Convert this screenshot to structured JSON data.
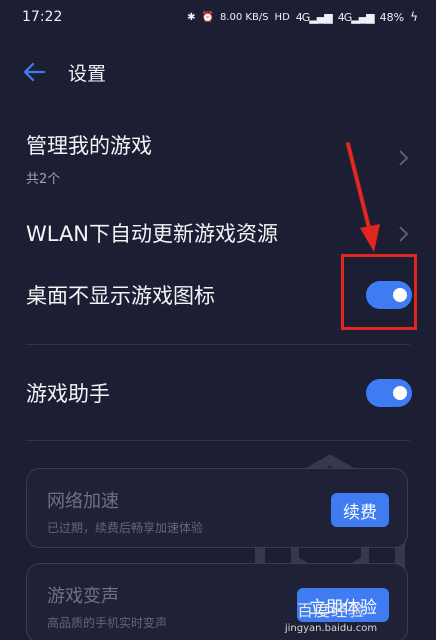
{
  "status_bar": {
    "time": "17:22",
    "network_speed": "8.00 KB/S",
    "hd_label": "HD",
    "signal_1": "4G",
    "signal_2": "4G",
    "battery": "48%"
  },
  "header": {
    "title": "设置"
  },
  "settings": {
    "manage_games": {
      "title": "管理我的游戏",
      "subtitle": "共2个"
    },
    "wlan_update": {
      "title": "WLAN下自动更新游戏资源"
    },
    "hide_icon": {
      "title": "桌面不显示游戏图标",
      "enabled": true
    },
    "game_assistant": {
      "title": "游戏助手",
      "enabled": true
    }
  },
  "cards": [
    {
      "title": "网络加速",
      "desc": "已过期，续费后畅享加速体验",
      "button": "续费"
    },
    {
      "title": "游戏变声",
      "desc": "高品质的手机实时变声",
      "button": "立即体验"
    }
  ],
  "watermark": {
    "main": "百度经验",
    "url": "jingyan.baidu.com"
  },
  "colors": {
    "background": "#1c1f33",
    "accent": "#3f7cf2",
    "highlight": "#e0261f"
  }
}
